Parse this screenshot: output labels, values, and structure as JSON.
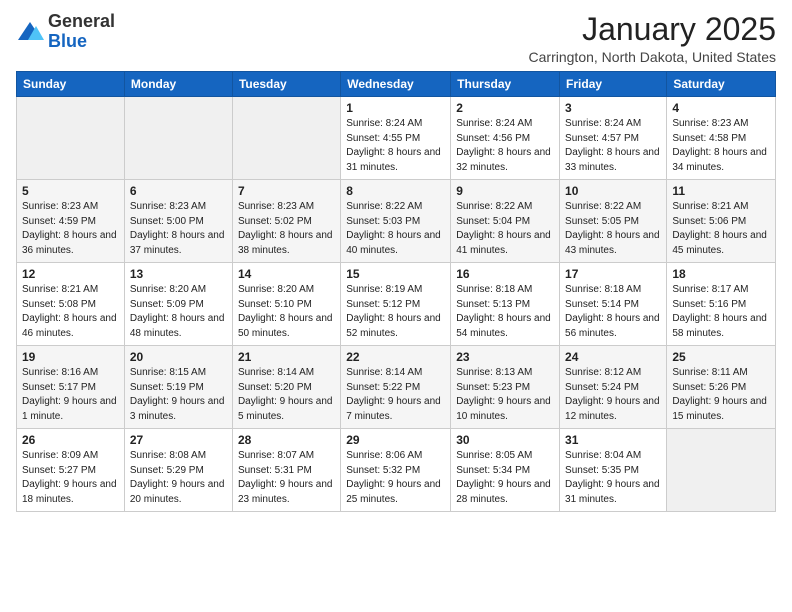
{
  "logo": {
    "general": "General",
    "blue": "Blue"
  },
  "header": {
    "month": "January 2025",
    "location": "Carrington, North Dakota, United States"
  },
  "days_of_week": [
    "Sunday",
    "Monday",
    "Tuesday",
    "Wednesday",
    "Thursday",
    "Friday",
    "Saturday"
  ],
  "weeks": [
    [
      {
        "day": "",
        "info": ""
      },
      {
        "day": "",
        "info": ""
      },
      {
        "day": "",
        "info": ""
      },
      {
        "day": "1",
        "info": "Sunrise: 8:24 AM\nSunset: 4:55 PM\nDaylight: 8 hours and 31 minutes."
      },
      {
        "day": "2",
        "info": "Sunrise: 8:24 AM\nSunset: 4:56 PM\nDaylight: 8 hours and 32 minutes."
      },
      {
        "day": "3",
        "info": "Sunrise: 8:24 AM\nSunset: 4:57 PM\nDaylight: 8 hours and 33 minutes."
      },
      {
        "day": "4",
        "info": "Sunrise: 8:23 AM\nSunset: 4:58 PM\nDaylight: 8 hours and 34 minutes."
      }
    ],
    [
      {
        "day": "5",
        "info": "Sunrise: 8:23 AM\nSunset: 4:59 PM\nDaylight: 8 hours and 36 minutes."
      },
      {
        "day": "6",
        "info": "Sunrise: 8:23 AM\nSunset: 5:00 PM\nDaylight: 8 hours and 37 minutes."
      },
      {
        "day": "7",
        "info": "Sunrise: 8:23 AM\nSunset: 5:02 PM\nDaylight: 8 hours and 38 minutes."
      },
      {
        "day": "8",
        "info": "Sunrise: 8:22 AM\nSunset: 5:03 PM\nDaylight: 8 hours and 40 minutes."
      },
      {
        "day": "9",
        "info": "Sunrise: 8:22 AM\nSunset: 5:04 PM\nDaylight: 8 hours and 41 minutes."
      },
      {
        "day": "10",
        "info": "Sunrise: 8:22 AM\nSunset: 5:05 PM\nDaylight: 8 hours and 43 minutes."
      },
      {
        "day": "11",
        "info": "Sunrise: 8:21 AM\nSunset: 5:06 PM\nDaylight: 8 hours and 45 minutes."
      }
    ],
    [
      {
        "day": "12",
        "info": "Sunrise: 8:21 AM\nSunset: 5:08 PM\nDaylight: 8 hours and 46 minutes."
      },
      {
        "day": "13",
        "info": "Sunrise: 8:20 AM\nSunset: 5:09 PM\nDaylight: 8 hours and 48 minutes."
      },
      {
        "day": "14",
        "info": "Sunrise: 8:20 AM\nSunset: 5:10 PM\nDaylight: 8 hours and 50 minutes."
      },
      {
        "day": "15",
        "info": "Sunrise: 8:19 AM\nSunset: 5:12 PM\nDaylight: 8 hours and 52 minutes."
      },
      {
        "day": "16",
        "info": "Sunrise: 8:18 AM\nSunset: 5:13 PM\nDaylight: 8 hours and 54 minutes."
      },
      {
        "day": "17",
        "info": "Sunrise: 8:18 AM\nSunset: 5:14 PM\nDaylight: 8 hours and 56 minutes."
      },
      {
        "day": "18",
        "info": "Sunrise: 8:17 AM\nSunset: 5:16 PM\nDaylight: 8 hours and 58 minutes."
      }
    ],
    [
      {
        "day": "19",
        "info": "Sunrise: 8:16 AM\nSunset: 5:17 PM\nDaylight: 9 hours and 1 minute."
      },
      {
        "day": "20",
        "info": "Sunrise: 8:15 AM\nSunset: 5:19 PM\nDaylight: 9 hours and 3 minutes."
      },
      {
        "day": "21",
        "info": "Sunrise: 8:14 AM\nSunset: 5:20 PM\nDaylight: 9 hours and 5 minutes."
      },
      {
        "day": "22",
        "info": "Sunrise: 8:14 AM\nSunset: 5:22 PM\nDaylight: 9 hours and 7 minutes."
      },
      {
        "day": "23",
        "info": "Sunrise: 8:13 AM\nSunset: 5:23 PM\nDaylight: 9 hours and 10 minutes."
      },
      {
        "day": "24",
        "info": "Sunrise: 8:12 AM\nSunset: 5:24 PM\nDaylight: 9 hours and 12 minutes."
      },
      {
        "day": "25",
        "info": "Sunrise: 8:11 AM\nSunset: 5:26 PM\nDaylight: 9 hours and 15 minutes."
      }
    ],
    [
      {
        "day": "26",
        "info": "Sunrise: 8:09 AM\nSunset: 5:27 PM\nDaylight: 9 hours and 18 minutes."
      },
      {
        "day": "27",
        "info": "Sunrise: 8:08 AM\nSunset: 5:29 PM\nDaylight: 9 hours and 20 minutes."
      },
      {
        "day": "28",
        "info": "Sunrise: 8:07 AM\nSunset: 5:31 PM\nDaylight: 9 hours and 23 minutes."
      },
      {
        "day": "29",
        "info": "Sunrise: 8:06 AM\nSunset: 5:32 PM\nDaylight: 9 hours and 25 minutes."
      },
      {
        "day": "30",
        "info": "Sunrise: 8:05 AM\nSunset: 5:34 PM\nDaylight: 9 hours and 28 minutes."
      },
      {
        "day": "31",
        "info": "Sunrise: 8:04 AM\nSunset: 5:35 PM\nDaylight: 9 hours and 31 minutes."
      },
      {
        "day": "",
        "info": ""
      }
    ]
  ]
}
